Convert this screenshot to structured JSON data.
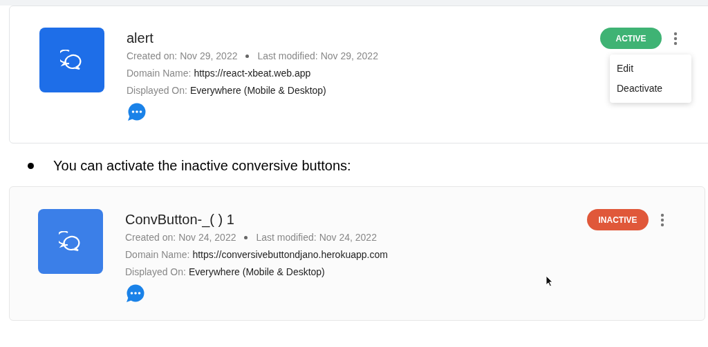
{
  "cards": [
    {
      "title": "alert",
      "created_label": "Created on:",
      "created": "Nov 29, 2022",
      "modified_label": "Last modified:",
      "modified": "Nov 29, 2022",
      "domain_label": "Domain Name:",
      "domain": "https://react-xbeat.web.app",
      "displayed_label": "Displayed On:",
      "displayed": "Everywhere (Mobile & Desktop)",
      "status": "ACTIVE",
      "active": true,
      "menu": {
        "items": [
          "Edit",
          "Deactivate"
        ]
      }
    },
    {
      "title": "ConvButton-_( ) 1",
      "created_label": "Created on:",
      "created": "Nov 24, 2022",
      "modified_label": "Last modified:",
      "modified": "Nov 24, 2022",
      "domain_label": "Domain Name:",
      "domain": "https://conversivebuttondjano.herokuapp.com",
      "displayed_label": "Displayed On:",
      "displayed": "Everywhere (Mobile & Desktop)",
      "status": "INACTIVE",
      "active": false
    }
  ],
  "bullet": "You can activate the inactive conversive buttons:"
}
